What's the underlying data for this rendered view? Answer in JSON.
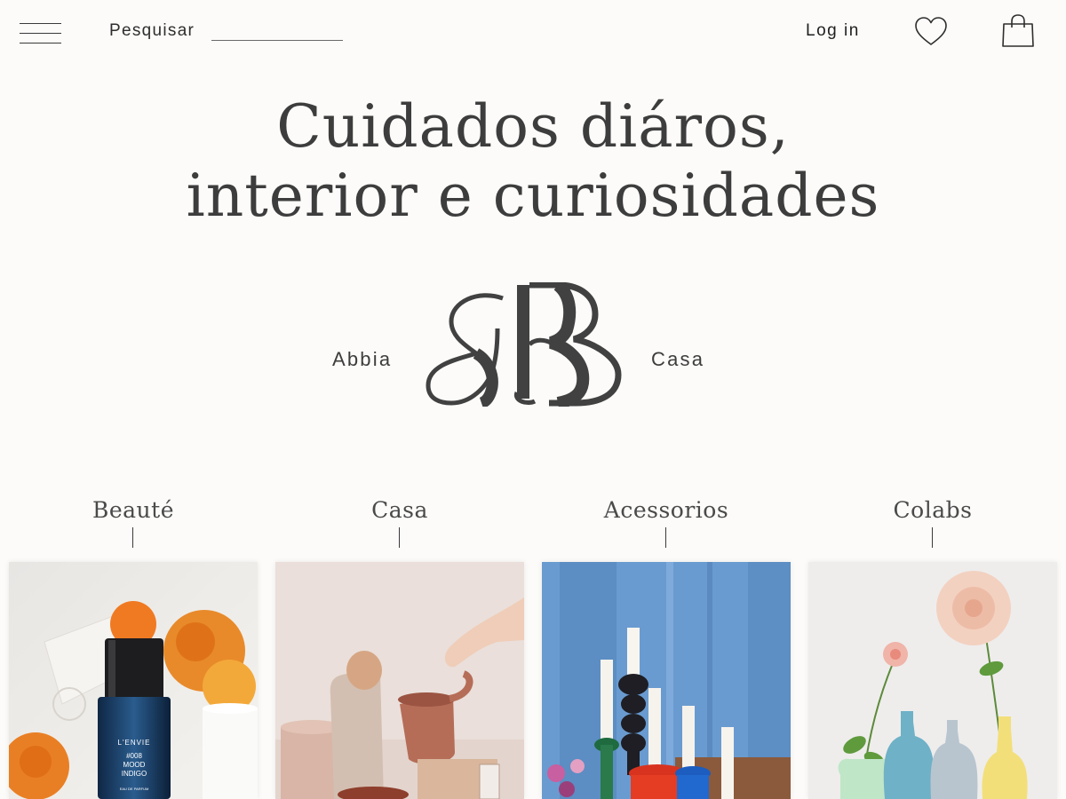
{
  "header": {
    "menu_icon": "hamburger-menu-icon",
    "search_label": "Pesquisar",
    "search_value": "",
    "login_label": "Log in",
    "wishlist_icon": "heart-icon",
    "cart_icon": "shopping-bag-icon"
  },
  "hero": {
    "title_line1": "Cuidados diáros,",
    "title_line2": "interior e curiosidades"
  },
  "brand": {
    "left_word": "Abbia",
    "right_word": "Casa",
    "logo_icon": "ab-monogram-logo"
  },
  "categories": [
    {
      "label": "Beauté",
      "image": "perfume-bottle-with-orange-flowers"
    },
    {
      "label": "Casa",
      "image": "ceramic-mug-and-clay-objects"
    },
    {
      "label": "Acessorios",
      "image": "colorful-candle-holders-with-candles"
    },
    {
      "label": "Colabs",
      "image": "pastel-ceramic-bottle-vases-with-flowers"
    }
  ],
  "perfume_label": {
    "brand": "L'ENVIE",
    "line1": "#008",
    "line2": "MOOD",
    "line3": "INDIGO",
    "line4": "EAU DE PARFUM"
  },
  "colors": {
    "background": "#fcfbf9",
    "text": "#3a3a3a",
    "perfume_blue": "#14304f",
    "candle_wall_blue": "#6a9bd0"
  }
}
